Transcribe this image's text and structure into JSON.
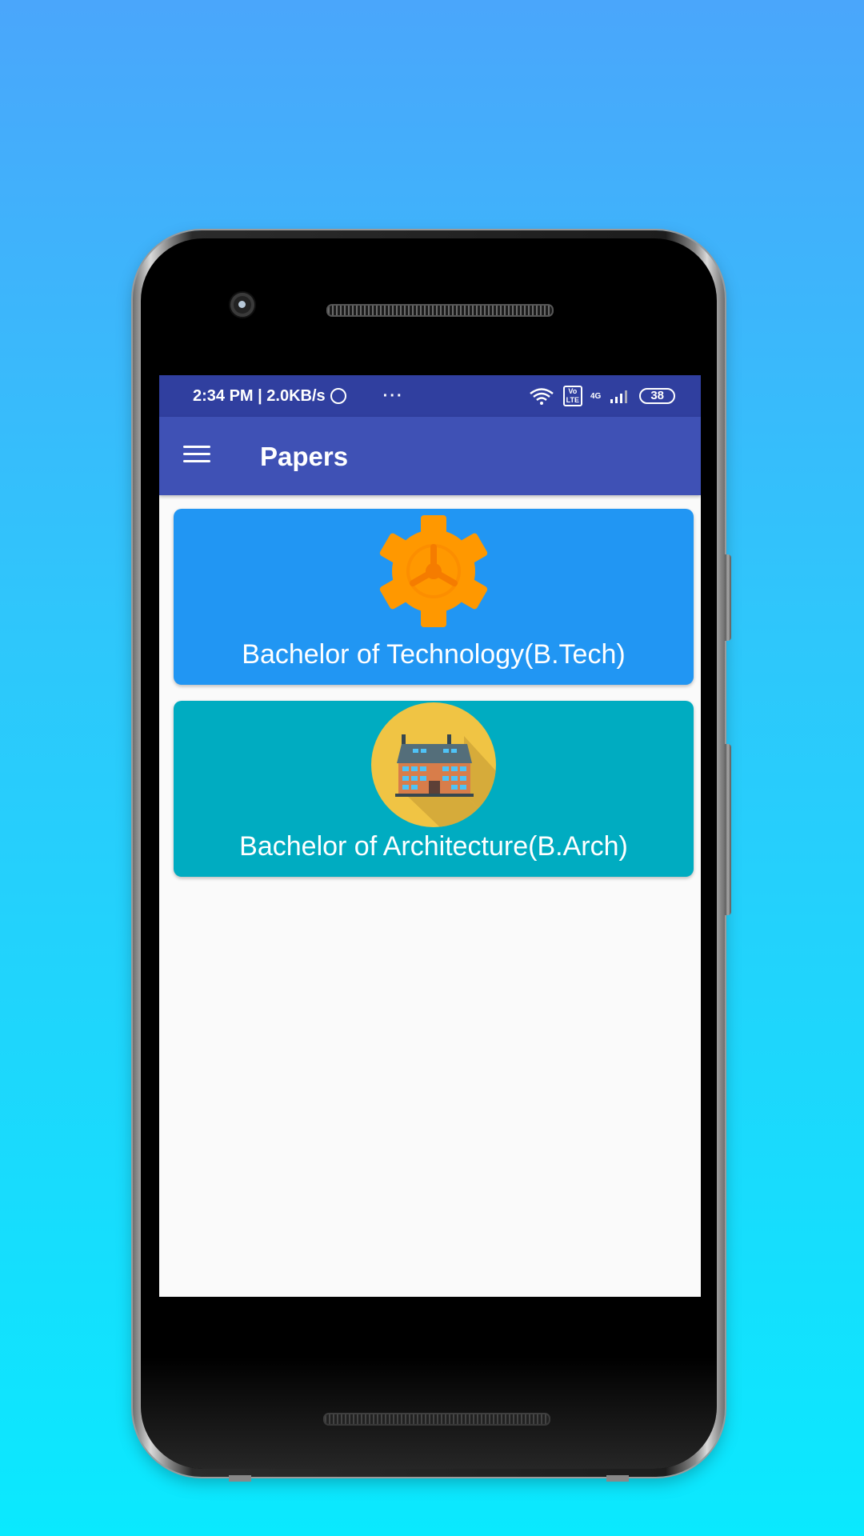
{
  "statusbar": {
    "time_speed": "2:34 PM | 2.0KB/s",
    "more": "···",
    "volte": "Vo\nLTE",
    "network": "4G",
    "battery": "38"
  },
  "toolbar": {
    "title": "Papers"
  },
  "courses": [
    {
      "label": "Bachelor of Technology(B.Tech)",
      "icon": "gear-icon",
      "color": "#2196f3"
    },
    {
      "label": "Bachelor of Architecture(B.Arch)",
      "icon": "building-icon",
      "color": "#00acc1"
    }
  ],
  "colors": {
    "statusbar": "#303f9f",
    "toolbar": "#3f51b5",
    "background_top": "#4aa6fb",
    "background_bottom": "#0ae9fe"
  }
}
